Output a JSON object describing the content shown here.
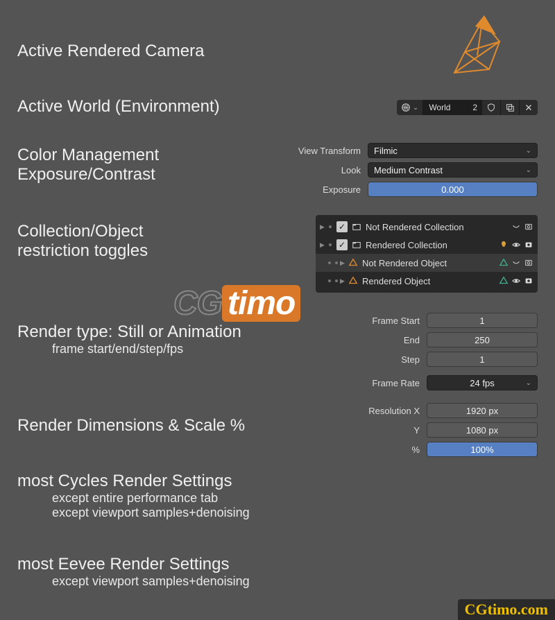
{
  "titles": {
    "camera": "Active Rendered Camera",
    "world": "Active World (Environment)",
    "color_mgmt_l1": "Color Management",
    "color_mgmt_l2": "Exposure/Contrast",
    "collection_l1": "Collection/Object",
    "collection_l2": "restriction toggles",
    "render_type": "Render type: Still or Animation",
    "render_type_sub": "frame start/end/step/fps",
    "dimensions": "Render Dimensions & Scale %",
    "cycles": "most Cycles Render Settings",
    "cycles_sub1": "except entire performance tab",
    "cycles_sub2": "except viewport samples+denoising",
    "eevee": "most Eevee Render Settings",
    "eevee_sub1": "except viewport samples+denoising"
  },
  "world_selector": {
    "name": "World",
    "users": "2"
  },
  "color_mgmt": {
    "view_transform_label": "View Transform",
    "view_transform_value": "Filmic",
    "look_label": "Look",
    "look_value": "Medium Contrast",
    "exposure_label": "Exposure",
    "exposure_value": "0.000"
  },
  "outliner": {
    "items": [
      {
        "name": "Not Rendered Collection",
        "checked": true,
        "type": "collection",
        "highlight": false
      },
      {
        "name": "Rendered Collection",
        "checked": true,
        "type": "collection",
        "highlight": false
      },
      {
        "name": "Not Rendered Object",
        "checked": false,
        "type": "object",
        "highlight": true
      },
      {
        "name": "Rendered Object",
        "checked": false,
        "type": "object",
        "highlight": false
      }
    ]
  },
  "anim": {
    "frame_start_label": "Frame Start",
    "frame_start": "1",
    "end_label": "End",
    "end": "250",
    "step_label": "Step",
    "step": "1",
    "frame_rate_label": "Frame Rate",
    "frame_rate": "24 fps"
  },
  "dims": {
    "res_x_label": "Resolution X",
    "res_x": "1920 px",
    "res_y_label": "Y",
    "res_y": "1080 px",
    "pct_label": "%",
    "pct": "100%"
  },
  "watermark": {
    "cg": "CG",
    "timo": "timo",
    "corner": "CGtimo.com"
  }
}
